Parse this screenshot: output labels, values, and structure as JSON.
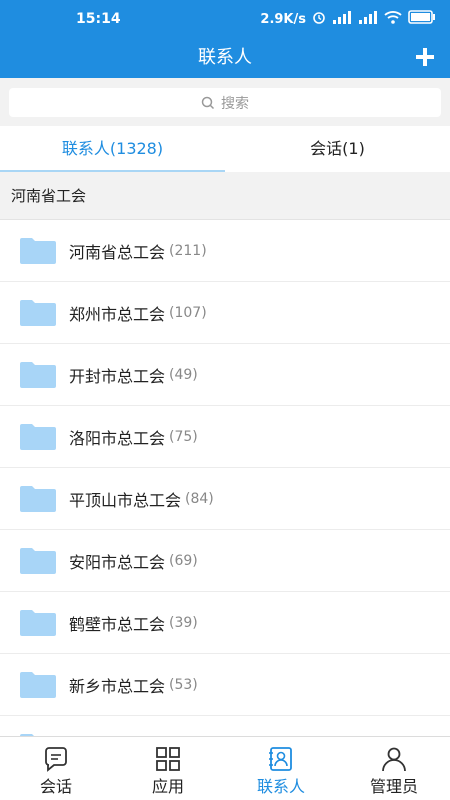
{
  "status_bar": {
    "time": "15:14",
    "speed": "2.9K/s",
    "icons": [
      "alarm-icon",
      "hd-signal-icon",
      "hd-signal-icon",
      "wifi-icon",
      "battery-icon"
    ]
  },
  "navbar": {
    "title": "联系人",
    "add_icon": "plus-icon"
  },
  "search": {
    "placeholder": "搜索",
    "icon": "search-icon"
  },
  "tabs": [
    {
      "label": "联系人(1328)",
      "active": true
    },
    {
      "label": "会话(1)",
      "active": false
    }
  ],
  "group": {
    "title": "河南省工会"
  },
  "rows": [
    {
      "name": "河南省总工会",
      "count": "(211)"
    },
    {
      "name": "郑州市总工会",
      "count": "(107)"
    },
    {
      "name": "开封市总工会",
      "count": "(49)"
    },
    {
      "name": "洛阳市总工会",
      "count": "(75)"
    },
    {
      "name": "平顶山市总工会",
      "count": "(84)"
    },
    {
      "name": "安阳市总工会",
      "count": "(69)"
    },
    {
      "name": "鹤壁市总工会",
      "count": "(39)"
    },
    {
      "name": "新乡市总工会",
      "count": "(53)"
    }
  ],
  "bottom_nav": [
    {
      "label": "会话",
      "icon": "chat-bubble-icon",
      "active": false
    },
    {
      "label": "应用",
      "icon": "grid-icon",
      "active": false
    },
    {
      "label": "联系人",
      "icon": "contacts-icon",
      "active": true
    },
    {
      "label": "管理员",
      "icon": "user-icon",
      "active": false
    }
  ],
  "colors": {
    "primary": "#1f8de0",
    "folder": "#a8d5f7",
    "background": "#f2f2f2"
  }
}
